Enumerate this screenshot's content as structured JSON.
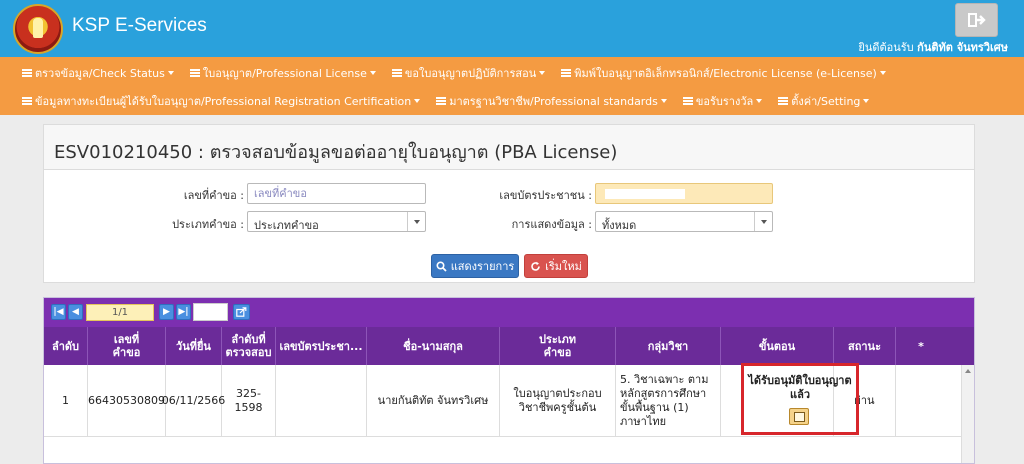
{
  "header": {
    "brand": "KSP E-Services",
    "welcome_prefix": "ยินดีต้อนรับ",
    "welcome_user": "กันติทัต จันทรวิเศษ"
  },
  "menu": {
    "row1": [
      "ตรวจข้อมูล/Check Status",
      "ใบอนุญาต/Professional License",
      "ขอใบอนุญาตปฏิบัติการสอน",
      "พิมพ์ใบอนุญาตอิเล็กทรอนิกส์/Electronic License (e-License)"
    ],
    "row2": [
      "ข้อมูลทางทะเบียนผู้ได้รับใบอนุญาต/Professional Registration Certification",
      "มาตรฐานวิชาชีพ/Professional standards",
      "ขอรับรางวัล",
      "ตั้งค่า/Setting"
    ]
  },
  "page": {
    "title": "ESV010210450 : ตรวจสอบข้อมูลขอต่ออายุใบอนุญาต (PBA License)"
  },
  "form": {
    "request_no_label": "เลขที่คำขอ :",
    "request_no_placeholder": "เลขที่คำขอ",
    "request_type_label": "ประเภทคำขอ :",
    "request_type_value": "ประเภทคำขอ",
    "citizen_id_label": "เลขบัตรประชาชน :",
    "display_label": "การแสดงข้อมูล :",
    "display_value": "ทั้งหมด",
    "search_button": "แสดงรายการ",
    "reset_button": "เริ่มใหม่"
  },
  "pager": {
    "page_display": "1/1"
  },
  "table": {
    "headers": [
      "ลำดับ",
      "เลขที่\nคำขอ",
      "วันที่ยื่น",
      "ลำดับที่\nตรวจสอบ",
      "เลขบัตรประชา...",
      "ชื่อ-นามสกุล",
      "ประเภท\nคำขอ",
      "กลุ่มวิชา",
      "ขั้นตอน",
      "สถานะ",
      "*"
    ],
    "rows": [
      {
        "no": "1",
        "request_no": "66430530809",
        "submit_date": "06/11/2566",
        "check_order": "325-1598",
        "citizen_id": "",
        "name": "นายกันติทัต จันทรวิเศษ",
        "request_type": "ใบอนุญาตประกอบวิชาชีพครูชั้นต้น",
        "subject_group": "5. วิชาเฉพาะ ตามหลักสูตรการศึกษาขั้นพื้นฐาน (1) ภาษาไทย",
        "step": "ได้รับอนุมัติใบอนุญาตแล้ว",
        "status": "ผ่าน"
      }
    ]
  }
}
